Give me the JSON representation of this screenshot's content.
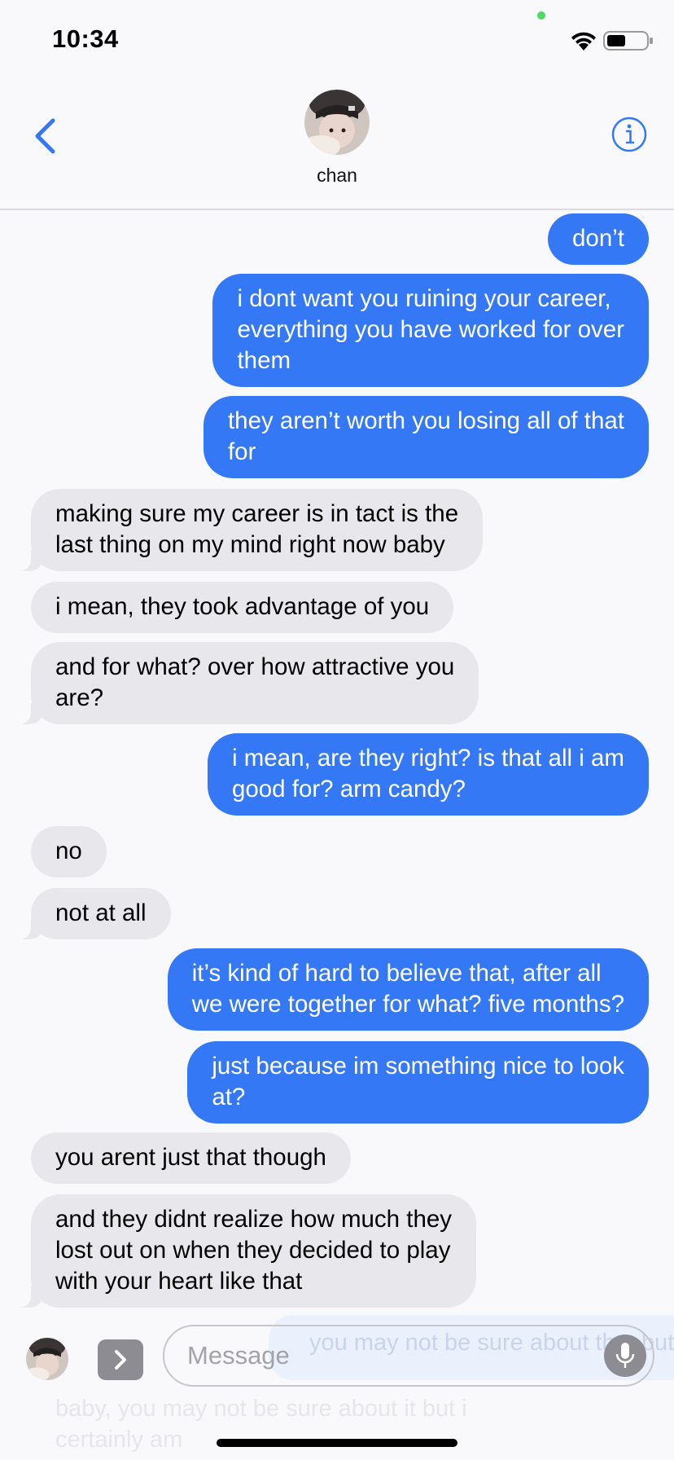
{
  "status_bar": {
    "time": "10:34"
  },
  "header": {
    "contact_name": "chan",
    "colors": {
      "accent": "#3478f6"
    }
  },
  "messages": [
    {
      "from": "me",
      "text": "don’t"
    },
    {
      "from": "me",
      "text": "i dont want you ruining your career,\neverything you have worked for over\nthem"
    },
    {
      "from": "me",
      "text": "they aren’t worth you losing all of that\nfor"
    },
    {
      "from": "them",
      "text": "making sure my career is in tact is the\nlast thing on my mind right now baby"
    },
    {
      "from": "them",
      "text": "i mean, they took advantage of you"
    },
    {
      "from": "them",
      "text": "and for what? over how attractive you\nare?"
    },
    {
      "from": "me",
      "text": "i mean, are they right? is that all i am\ngood for? arm candy?"
    },
    {
      "from": "them",
      "text": "no"
    },
    {
      "from": "them",
      "text": "not at all"
    },
    {
      "from": "me",
      "text": "it’s kind of hard to believe that, after all\nwe were together for what? five months?"
    },
    {
      "from": "me",
      "text": "just because im something nice to look\nat?"
    },
    {
      "from": "them",
      "text": "you arent just that though"
    },
    {
      "from": "them",
      "text": "and they didnt realize how much they\nlost out on when they decided to play\nwith your heart like that"
    }
  ],
  "composer": {
    "placeholder": "Message",
    "ghost_preview": "you may not be sure about that but",
    "ghost_preview_2": "baby, you may not be sure about it but i\ncertainly am"
  },
  "colors": {
    "sent_bubble": "#3478f6",
    "received_bubble": "#e8e8ec",
    "background": "#f9f9fb"
  }
}
